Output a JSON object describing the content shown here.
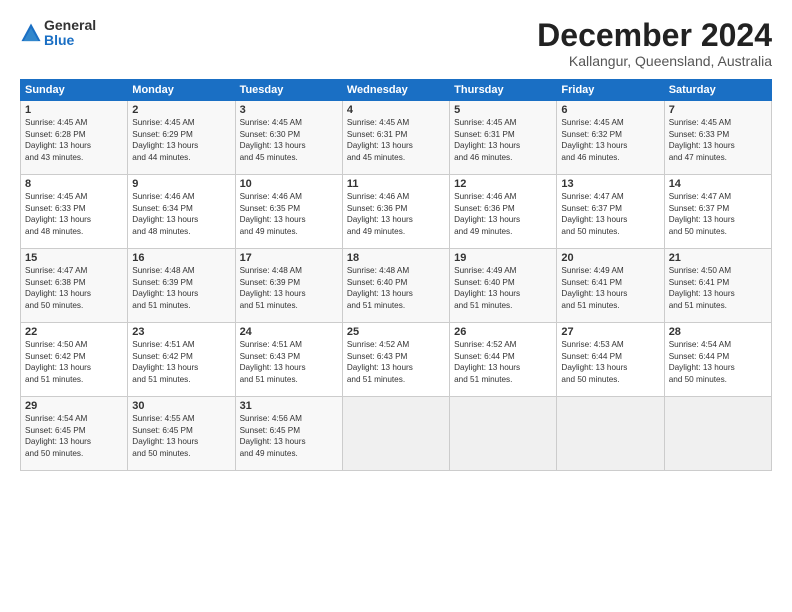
{
  "logo": {
    "general": "General",
    "blue": "Blue"
  },
  "title": "December 2024",
  "subtitle": "Kallangur, Queensland, Australia",
  "headers": [
    "Sunday",
    "Monday",
    "Tuesday",
    "Wednesday",
    "Thursday",
    "Friday",
    "Saturday"
  ],
  "rows": [
    [
      {
        "day": "1",
        "info": "Sunrise: 4:45 AM\nSunset: 6:28 PM\nDaylight: 13 hours\nand 43 minutes."
      },
      {
        "day": "2",
        "info": "Sunrise: 4:45 AM\nSunset: 6:29 PM\nDaylight: 13 hours\nand 44 minutes."
      },
      {
        "day": "3",
        "info": "Sunrise: 4:45 AM\nSunset: 6:30 PM\nDaylight: 13 hours\nand 45 minutes."
      },
      {
        "day": "4",
        "info": "Sunrise: 4:45 AM\nSunset: 6:31 PM\nDaylight: 13 hours\nand 45 minutes."
      },
      {
        "day": "5",
        "info": "Sunrise: 4:45 AM\nSunset: 6:31 PM\nDaylight: 13 hours\nand 46 minutes."
      },
      {
        "day": "6",
        "info": "Sunrise: 4:45 AM\nSunset: 6:32 PM\nDaylight: 13 hours\nand 46 minutes."
      },
      {
        "day": "7",
        "info": "Sunrise: 4:45 AM\nSunset: 6:33 PM\nDaylight: 13 hours\nand 47 minutes."
      }
    ],
    [
      {
        "day": "8",
        "info": "Sunrise: 4:45 AM\nSunset: 6:33 PM\nDaylight: 13 hours\nand 48 minutes."
      },
      {
        "day": "9",
        "info": "Sunrise: 4:46 AM\nSunset: 6:34 PM\nDaylight: 13 hours\nand 48 minutes."
      },
      {
        "day": "10",
        "info": "Sunrise: 4:46 AM\nSunset: 6:35 PM\nDaylight: 13 hours\nand 49 minutes."
      },
      {
        "day": "11",
        "info": "Sunrise: 4:46 AM\nSunset: 6:36 PM\nDaylight: 13 hours\nand 49 minutes."
      },
      {
        "day": "12",
        "info": "Sunrise: 4:46 AM\nSunset: 6:36 PM\nDaylight: 13 hours\nand 49 minutes."
      },
      {
        "day": "13",
        "info": "Sunrise: 4:47 AM\nSunset: 6:37 PM\nDaylight: 13 hours\nand 50 minutes."
      },
      {
        "day": "14",
        "info": "Sunrise: 4:47 AM\nSunset: 6:37 PM\nDaylight: 13 hours\nand 50 minutes."
      }
    ],
    [
      {
        "day": "15",
        "info": "Sunrise: 4:47 AM\nSunset: 6:38 PM\nDaylight: 13 hours\nand 50 minutes."
      },
      {
        "day": "16",
        "info": "Sunrise: 4:48 AM\nSunset: 6:39 PM\nDaylight: 13 hours\nand 51 minutes."
      },
      {
        "day": "17",
        "info": "Sunrise: 4:48 AM\nSunset: 6:39 PM\nDaylight: 13 hours\nand 51 minutes."
      },
      {
        "day": "18",
        "info": "Sunrise: 4:48 AM\nSunset: 6:40 PM\nDaylight: 13 hours\nand 51 minutes."
      },
      {
        "day": "19",
        "info": "Sunrise: 4:49 AM\nSunset: 6:40 PM\nDaylight: 13 hours\nand 51 minutes."
      },
      {
        "day": "20",
        "info": "Sunrise: 4:49 AM\nSunset: 6:41 PM\nDaylight: 13 hours\nand 51 minutes."
      },
      {
        "day": "21",
        "info": "Sunrise: 4:50 AM\nSunset: 6:41 PM\nDaylight: 13 hours\nand 51 minutes."
      }
    ],
    [
      {
        "day": "22",
        "info": "Sunrise: 4:50 AM\nSunset: 6:42 PM\nDaylight: 13 hours\nand 51 minutes."
      },
      {
        "day": "23",
        "info": "Sunrise: 4:51 AM\nSunset: 6:42 PM\nDaylight: 13 hours\nand 51 minutes."
      },
      {
        "day": "24",
        "info": "Sunrise: 4:51 AM\nSunset: 6:43 PM\nDaylight: 13 hours\nand 51 minutes."
      },
      {
        "day": "25",
        "info": "Sunrise: 4:52 AM\nSunset: 6:43 PM\nDaylight: 13 hours\nand 51 minutes."
      },
      {
        "day": "26",
        "info": "Sunrise: 4:52 AM\nSunset: 6:44 PM\nDaylight: 13 hours\nand 51 minutes."
      },
      {
        "day": "27",
        "info": "Sunrise: 4:53 AM\nSunset: 6:44 PM\nDaylight: 13 hours\nand 50 minutes."
      },
      {
        "day": "28",
        "info": "Sunrise: 4:54 AM\nSunset: 6:44 PM\nDaylight: 13 hours\nand 50 minutes."
      }
    ],
    [
      {
        "day": "29",
        "info": "Sunrise: 4:54 AM\nSunset: 6:45 PM\nDaylight: 13 hours\nand 50 minutes."
      },
      {
        "day": "30",
        "info": "Sunrise: 4:55 AM\nSunset: 6:45 PM\nDaylight: 13 hours\nand 50 minutes."
      },
      {
        "day": "31",
        "info": "Sunrise: 4:56 AM\nSunset: 6:45 PM\nDaylight: 13 hours\nand 49 minutes."
      },
      {
        "day": "",
        "info": ""
      },
      {
        "day": "",
        "info": ""
      },
      {
        "day": "",
        "info": ""
      },
      {
        "day": "",
        "info": ""
      }
    ]
  ]
}
